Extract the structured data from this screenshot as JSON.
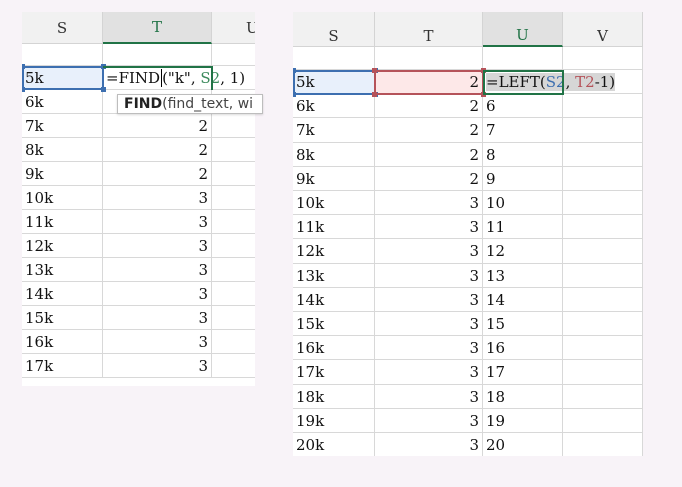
{
  "left_sheet": {
    "columns": [
      "S",
      "T",
      "U"
    ],
    "selected_column": "T",
    "rows": [
      {
        "s": "",
        "t": ""
      },
      {
        "s": "5k",
        "t": ""
      },
      {
        "s": "6k",
        "t": ""
      },
      {
        "s": "7k",
        "t": "2"
      },
      {
        "s": "8k",
        "t": "2"
      },
      {
        "s": "9k",
        "t": "2"
      },
      {
        "s": "10k",
        "t": "3"
      },
      {
        "s": "11k",
        "t": "3"
      },
      {
        "s": "12k",
        "t": "3"
      },
      {
        "s": "13k",
        "t": "3"
      },
      {
        "s": "14k",
        "t": "3"
      },
      {
        "s": "15k",
        "t": "3"
      },
      {
        "s": "16k",
        "t": "3"
      },
      {
        "s": "17k",
        "t": "3"
      }
    ],
    "formula": {
      "prefix": "=FIND",
      "paren_open": "(",
      "arg1": "\"k\"",
      "sep1": ", ",
      "arg2": "S2",
      "rest": ", 1)"
    },
    "tooltip": {
      "func": "FIND",
      "args": "(find_text, wi"
    }
  },
  "right_sheet": {
    "columns": [
      "S",
      "T",
      "U",
      "V"
    ],
    "selected_column": "U",
    "rows": [
      {
        "s": "",
        "t": "",
        "u": ""
      },
      {
        "s": "5k",
        "t": "2",
        "u": ""
      },
      {
        "s": "6k",
        "t": "2",
        "u": "6"
      },
      {
        "s": "7k",
        "t": "2",
        "u": "7"
      },
      {
        "s": "8k",
        "t": "2",
        "u": "8"
      },
      {
        "s": "9k",
        "t": "2",
        "u": "9"
      },
      {
        "s": "10k",
        "t": "3",
        "u": "10"
      },
      {
        "s": "11k",
        "t": "3",
        "u": "11"
      },
      {
        "s": "12k",
        "t": "3",
        "u": "12"
      },
      {
        "s": "13k",
        "t": "3",
        "u": "13"
      },
      {
        "s": "14k",
        "t": "3",
        "u": "14"
      },
      {
        "s": "15k",
        "t": "3",
        "u": "15"
      },
      {
        "s": "16k",
        "t": "3",
        "u": "16"
      },
      {
        "s": "17k",
        "t": "3",
        "u": "17"
      },
      {
        "s": "18k",
        "t": "3",
        "u": "18"
      },
      {
        "s": "19k",
        "t": "3",
        "u": "19"
      },
      {
        "s": "20k",
        "t": "3",
        "u": "20"
      }
    ],
    "formula": {
      "prefix": "=LEFT(",
      "arg1": "S2",
      "sep1": ", ",
      "arg2": "T2",
      "rest": "-1)"
    }
  },
  "colors": {
    "selection_green": "#217346",
    "ref_blue": "#3d6fb0",
    "ref_red": "#b5535a",
    "ref_green": "#3c8a5c"
  }
}
